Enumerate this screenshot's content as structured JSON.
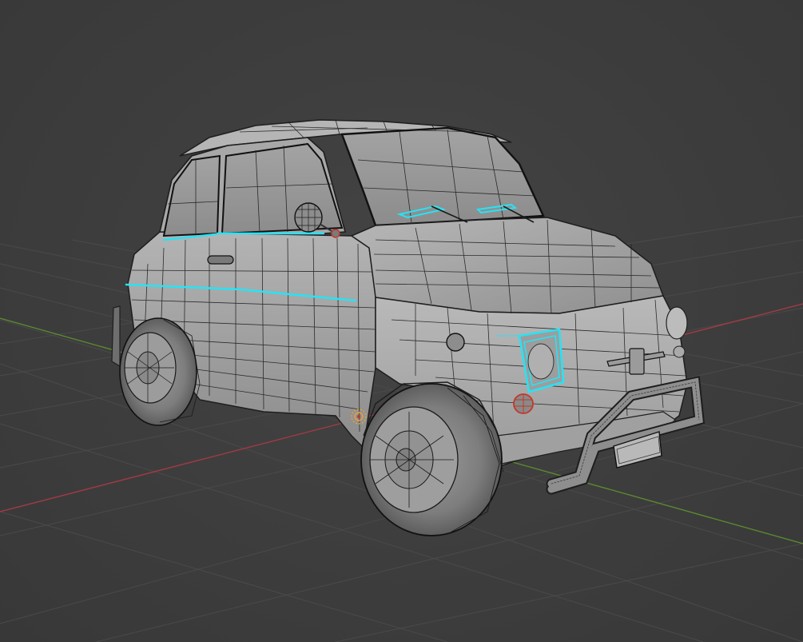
{
  "viewport": {
    "mode": "edit-mode",
    "shading": "solid",
    "overlay": "wireframe",
    "selected_edge_color": "#27e3f5",
    "background_color": "#3d3d3d",
    "grid_color": "#4c4c4c",
    "axis_x_color": "#a33a45",
    "axis_y_color": "#5b8a2f",
    "mesh_color": "#a9a9a9",
    "wire_color": "#1e1e1e"
  },
  "scene": {
    "object": "car-model",
    "icons": [
      "light-empty-icon",
      "light-empty-icon"
    ]
  }
}
